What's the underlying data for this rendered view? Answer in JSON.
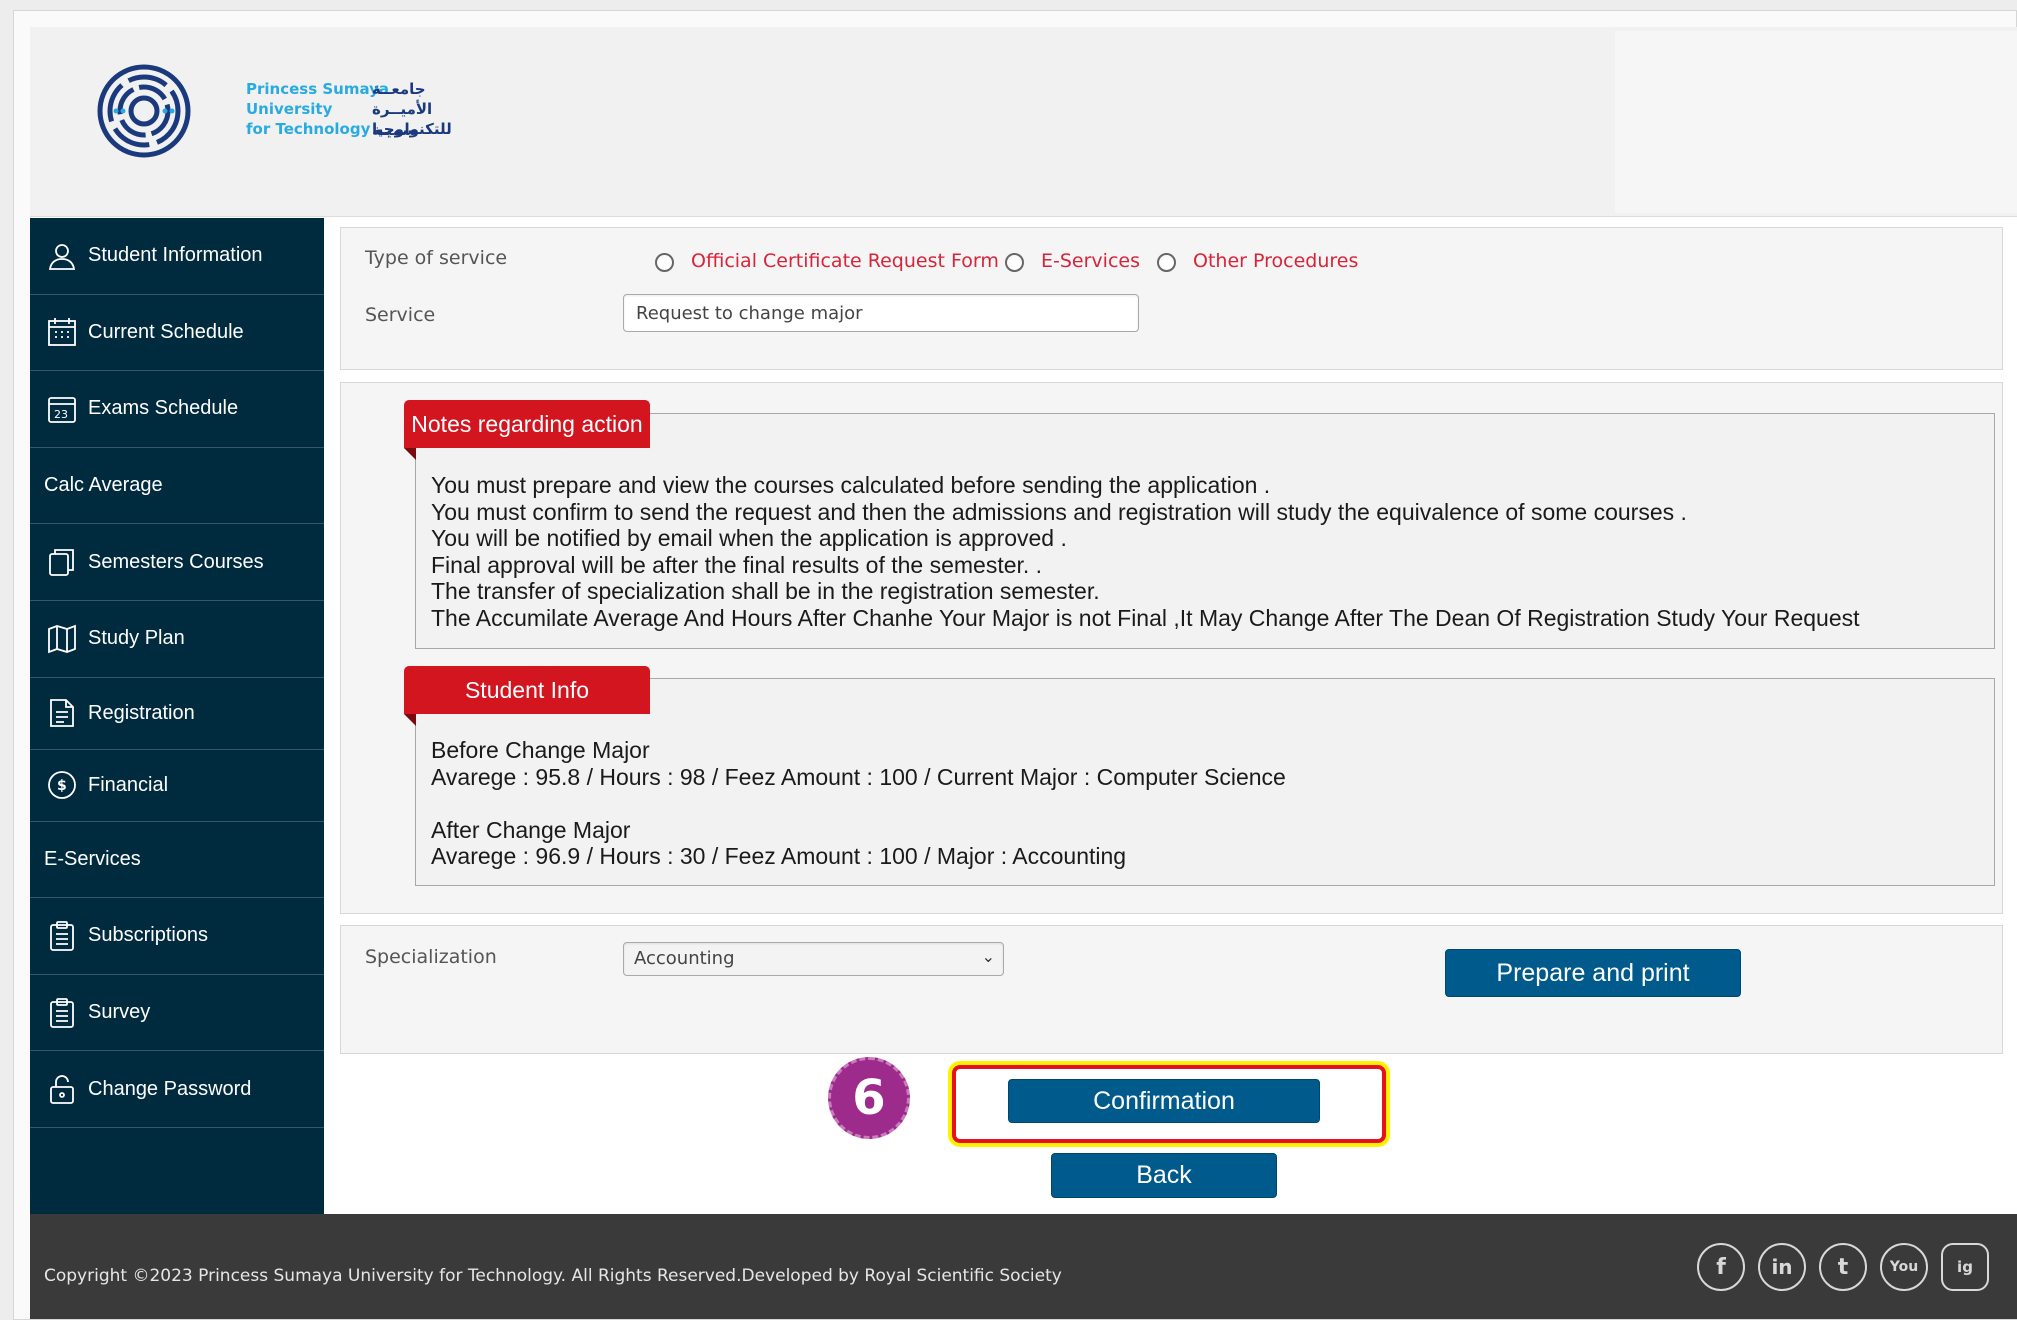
{
  "logo": {
    "en_lines": [
      "Princess Sumaya",
      "University",
      "for Technology"
    ],
    "ar_lines": [
      "جامعــة",
      "الأميــرة سميـة",
      "للتكنولوجيا"
    ]
  },
  "sidebar": {
    "items": [
      {
        "label": "Student Information",
        "icon": "user-icon"
      },
      {
        "label": "Current Schedule",
        "icon": "calendar-icon"
      },
      {
        "label": "Exams Schedule",
        "icon": "calendar-23-icon"
      },
      {
        "label": "Calc Average",
        "icon": ""
      },
      {
        "label": "Semesters Courses",
        "icon": "copy-icon"
      },
      {
        "label": "Study Plan",
        "icon": "map-icon"
      },
      {
        "label": "Registration",
        "icon": "document-icon"
      },
      {
        "label": "Financial",
        "icon": "dollar-icon"
      },
      {
        "label": "E-Services",
        "icon": ""
      },
      {
        "label": "Subscriptions",
        "icon": "clipboard-icon"
      },
      {
        "label": "Survey",
        "icon": "clipboard-icon"
      },
      {
        "label": "Change Password",
        "icon": "lock-icon"
      }
    ]
  },
  "service_panel": {
    "type_label": "Type of service",
    "options": [
      "Official Certificate Request Form",
      "E-Services",
      "Other Procedures"
    ],
    "service_label": "Service",
    "service_value": "Request to change major"
  },
  "notes": {
    "title": "Notes regarding action",
    "lines": [
      "You must prepare and view the courses calculated before sending the application .",
      "You must confirm to send the request and then the admissions and registration will study the equivalence of some courses .",
      "You will be notified by email when the application is approved .",
      "Final approval will be after the final results of the semester. .",
      "The transfer of specialization shall be in the registration semester.",
      "The Accumilate Average And Hours After Chanhe Your Major is not Final ,It May Change After The Dean Of Registration Study Your Request"
    ]
  },
  "student_info": {
    "title": "Student Info",
    "before_heading": "Before Change Major",
    "before_line": "Avarege : 95.8 / Hours : 98 / Feez Amount : 100 / Current Major : Computer Science",
    "after_heading": "After Change Major",
    "after_line": "Avarege : 96.9 / Hours : 30 / Feez Amount : 100 / Major : Accounting"
  },
  "specialization": {
    "label": "Specialization",
    "selected": "Accounting"
  },
  "buttons": {
    "prepare": "Prepare and print",
    "confirm": "Confirmation",
    "back": "Back"
  },
  "step_badge": "6",
  "colors": {
    "sidebar_bg": "#002a3e",
    "accent_red": "#d3151f",
    "button_blue": "#005a8c",
    "highlight_yellow": "#fff200",
    "badge_purple": "#9c2b8b"
  },
  "footer": {
    "copyright": "Copyright ©2023 Princess Sumaya University for Technology. All Rights Reserved.Developed by Royal Scientific Society",
    "social": [
      "f",
      "in",
      "t",
      "You",
      "ig"
    ]
  }
}
